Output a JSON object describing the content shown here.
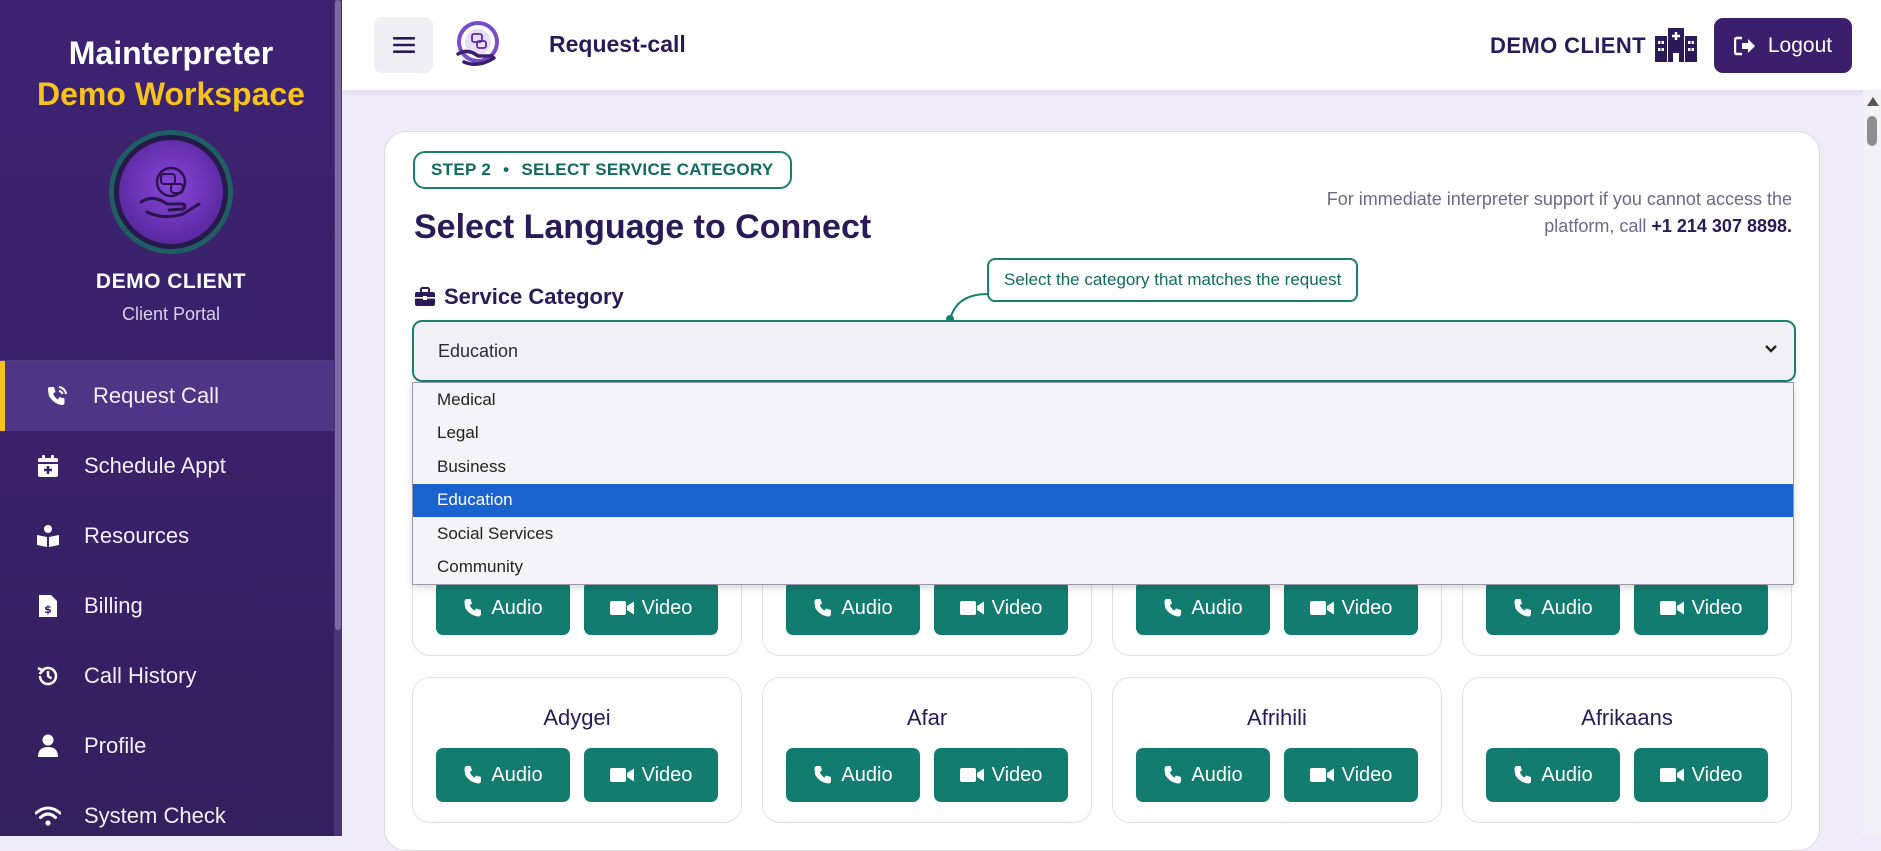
{
  "sidebar": {
    "brand_name": "Mainterpreter",
    "brand_workspace": "Demo Workspace",
    "client_name": "DEMO CLIENT",
    "client_role": "Client Portal",
    "items": [
      {
        "label": "Request Call",
        "icon": "phone-volume-icon",
        "active": true
      },
      {
        "label": "Schedule Appt",
        "icon": "calendar-plus-icon"
      },
      {
        "label": "Resources",
        "icon": "book-reader-icon"
      },
      {
        "label": "Billing",
        "icon": "invoice-dollar-icon"
      },
      {
        "label": "Call History",
        "icon": "history-icon"
      },
      {
        "label": "Profile",
        "icon": "user-icon"
      },
      {
        "label": "System Check",
        "icon": "wifi-icon"
      }
    ]
  },
  "header": {
    "title": "Request-call",
    "client": "DEMO CLIENT",
    "logout_label": "Logout"
  },
  "main": {
    "step_label": "STEP 2",
    "step_dot": "•",
    "step_name": "SELECT SERVICE CATEGORY",
    "title": "Select Language to Connect",
    "support_text": "For immediate interpreter support if you cannot access the platform, call",
    "support_phone": "+1 214 307 8898.",
    "hint": "Select the category that matches the request",
    "category_label": "Service Category",
    "selected_category": "Education",
    "category_options": [
      "Medical",
      "Legal",
      "Business",
      "Education",
      "Social Services",
      "Community"
    ]
  },
  "languages": {
    "audio_label": "Audio",
    "video_label": "Video",
    "row2": [
      "Adygei",
      "Afar",
      "Afrihili",
      "Afrikaans"
    ]
  },
  "colors": {
    "sidebar_bg": "#3d2272",
    "accent_yellow": "#f6c21c",
    "teal": "#137c70",
    "dropdown_selected": "#1a63cf"
  }
}
